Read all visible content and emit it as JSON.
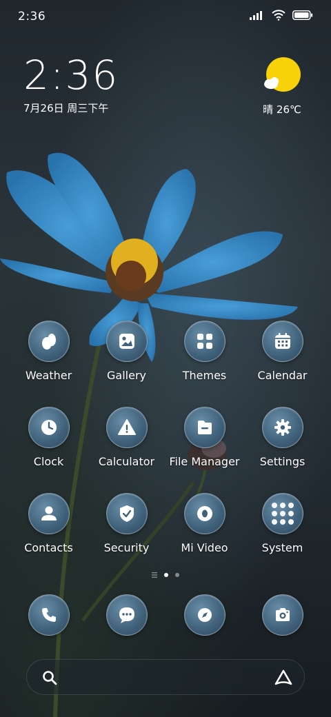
{
  "status_bar": {
    "time": "2:36",
    "icons": [
      "signal-icon",
      "wifi-icon",
      "battery-icon"
    ]
  },
  "clock_widget": {
    "time": "2:36",
    "date": "7月26日 周三下午"
  },
  "weather_widget": {
    "temperature_text": "晴 26℃",
    "icon": "sunny-cloud-icon"
  },
  "apps": [
    {
      "label": "Weather",
      "icon": "weather-icon"
    },
    {
      "label": "Gallery",
      "icon": "gallery-icon"
    },
    {
      "label": "Themes",
      "icon": "themes-icon"
    },
    {
      "label": "Calendar",
      "icon": "calendar-icon"
    },
    {
      "label": "Clock",
      "icon": "clock-icon"
    },
    {
      "label": "Calculator",
      "icon": "calculator-icon"
    },
    {
      "label": "File Manager",
      "icon": "folder-icon"
    },
    {
      "label": "Settings",
      "icon": "gear-icon"
    },
    {
      "label": "Contacts",
      "icon": "contacts-icon"
    },
    {
      "label": "Security",
      "icon": "shield-icon"
    },
    {
      "label": "Mi Video",
      "icon": "video-icon"
    },
    {
      "label": "System",
      "icon": "folder-grid-icon"
    }
  ],
  "page_indicator": {
    "pages": 2,
    "active": 1
  },
  "dock": [
    {
      "icon": "phone-icon"
    },
    {
      "icon": "messages-icon"
    },
    {
      "icon": "browser-icon"
    },
    {
      "icon": "camera-icon"
    }
  ],
  "search": {
    "icon": "search-icon",
    "assistant_icon": "assistant-icon"
  },
  "colors": {
    "icon_fill": "#3f6079",
    "weather_sun": "#f7d20a",
    "flower": "#3b8fcf"
  }
}
